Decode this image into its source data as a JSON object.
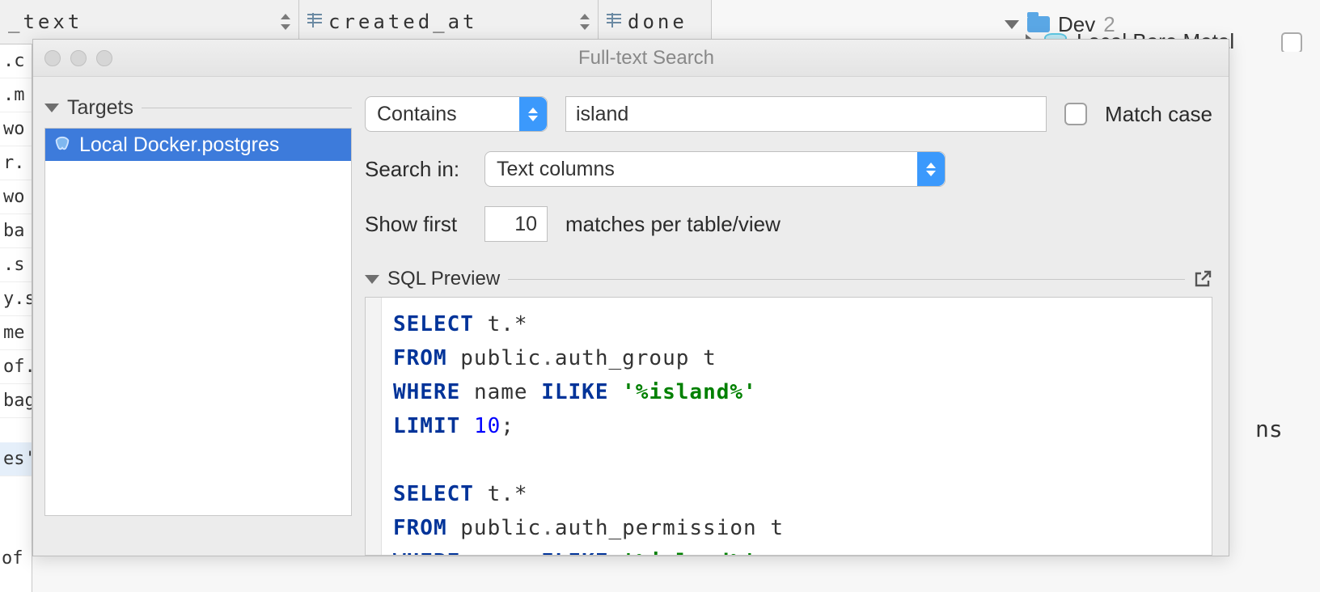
{
  "columns": {
    "c1": "_text",
    "c2": "created_at",
    "c3": "done"
  },
  "left_cells": [
    ".c",
    ".m",
    "wo",
    "r.",
    "wo",
    "ba",
    ".s",
    "y.s",
    "me",
    "of.",
    "bag"
  ],
  "left_selected": "es'",
  "left_footer": "of",
  "tree": {
    "group_name": "Dev",
    "group_count": "2",
    "datasource_name": "Local Bare Metal"
  },
  "right_tail": "ns",
  "dialog": {
    "title": "Full-text Search",
    "targets_label": "Targets",
    "target_item": "Local Docker.postgres",
    "match_mode": "Contains",
    "query": "island",
    "match_case_label": "Match case",
    "search_in_label": "Search in:",
    "search_in_value": "Text columns",
    "show_first_label": "Show first",
    "show_first_value": "10",
    "matches_label": "matches per table/view",
    "sql_preview_label": "SQL Preview"
  },
  "sql": {
    "kw_select": "SELECT",
    "kw_from": "FROM",
    "kw_where": "WHERE",
    "kw_ilike": "ILIKE",
    "kw_limit": "LIMIT",
    "t_star": "t.*",
    "schema": "public",
    "tbl1": "auth_group",
    "tbl2": "auth_permission",
    "alias": "t",
    "col": "name",
    "pattern": "'%island%'",
    "limit_n": "10"
  }
}
